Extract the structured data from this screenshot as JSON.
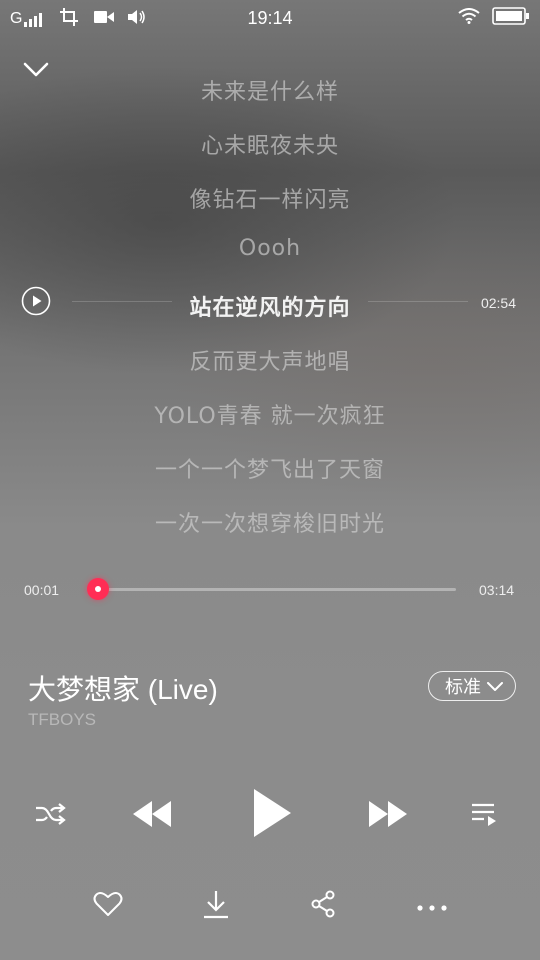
{
  "status_bar": {
    "signal": "G",
    "time": "19:14"
  },
  "lyrics": {
    "lines": [
      "未来是什么样",
      "心未眠夜未央",
      "像钻石一样闪亮",
      "Oooh",
      "站在逆风的方向",
      "反而更大声地唱",
      "YOLO青春 就一次疯狂",
      "一个一个梦飞出了天窗",
      "一次一次想穿梭旧时光"
    ],
    "current_index": 4,
    "current_time": "02:54"
  },
  "progress": {
    "elapsed": "00:01",
    "total": "03:14",
    "fraction": 0.005
  },
  "song": {
    "title": "大梦想家 (Live)",
    "artist": "TFBOYS",
    "quality": "标准"
  },
  "colors": {
    "accent": "#ff2d55"
  },
  "icons": {
    "collapse": "chevron-down-icon",
    "lyric_play": "play-circle-icon",
    "shuffle": "shuffle-icon",
    "previous": "previous-icon",
    "play": "play-icon",
    "next": "next-icon",
    "playlist": "playlist-icon",
    "like": "heart-icon",
    "download": "download-icon",
    "share": "share-icon",
    "more": "more-icon"
  }
}
